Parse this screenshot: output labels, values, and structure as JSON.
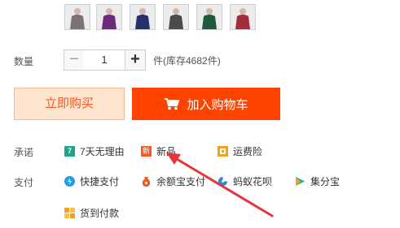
{
  "thumbnails": [
    {
      "name": "gray",
      "color": "#7b7373"
    },
    {
      "name": "purple",
      "color": "#6b2a7a"
    },
    {
      "name": "navy",
      "color": "#26306b"
    },
    {
      "name": "charcoal",
      "color": "#4b4b4b"
    },
    {
      "name": "green",
      "color": "#1f5a3a"
    },
    {
      "name": "red",
      "color": "#a52a3a"
    }
  ],
  "quantity": {
    "label": "数量",
    "value": "1",
    "minus": "−",
    "plus": "+",
    "stock_text": "件(库存4682件)"
  },
  "buttons": {
    "buy_now": "立即购买",
    "add_to_cart": "加入购物车"
  },
  "promise": {
    "label": "承诺",
    "items": [
      {
        "label": "7天无理由",
        "icon": "seven-days-icon",
        "color": "#1aa584",
        "glyph": "7"
      },
      {
        "label": "新品",
        "icon": "new-icon",
        "color": "#f15a24",
        "glyph": "新"
      },
      {
        "label": "运费险",
        "icon": "shipping-insurance-icon",
        "color": "#f3a01b",
        "glyph": ""
      }
    ]
  },
  "payment": {
    "label": "支付",
    "items": [
      {
        "label": "快捷支付",
        "icon": "quick-pay-icon",
        "color": "#1c9ee8"
      },
      {
        "label": "余额宝支付",
        "icon": "yuebao-icon",
        "color": "#f15a24"
      },
      {
        "label": "蚂蚁花呗",
        "icon": "huabei-icon",
        "color": "#1a8fe0"
      },
      {
        "label": "集分宝",
        "icon": "jifenbao-icon",
        "color": "#3bb34a"
      },
      {
        "label": "货到付款",
        "icon": "cod-icon",
        "color": "#f3a01b"
      }
    ]
  },
  "colors": {
    "accent": "#ff4400",
    "arrow": "#e8343c"
  }
}
